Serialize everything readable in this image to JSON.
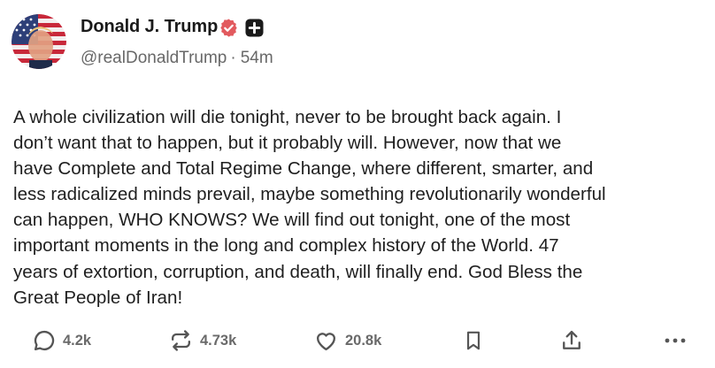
{
  "post": {
    "author": {
      "display_name": "Donald J. Trump",
      "handle": "@realDonaldTrump",
      "separator": "·",
      "time_ago": "54m"
    },
    "text": "A whole civilization will die tonight, never to be brought back again. I\ndon’t want that to happen, but it probably will. However, now that we\nhave Complete and Total Regime Change, where different, smarter, and\nless radicalized minds prevail, maybe something revolutionarily wonderful\ncan happen, WHO KNOWS? We will find out tonight, one of the most\nimportant moments in the long and complex history of the World. 47\nyears of extortion, corruption, and death, will finally end. God Bless the\nGreat People of Iran!",
    "actions": {
      "replies": "4.2k",
      "retruths": "4.73k",
      "likes": "20.8k"
    }
  },
  "icons": {
    "verified": "verified-badge-icon",
    "plus_badge": "plus-square-icon",
    "reply": "speech-bubble-icon",
    "retruth": "repost-arrows-icon",
    "like": "heart-icon",
    "bookmark": "bookmark-icon",
    "share": "share-upload-icon",
    "more": "ellipsis-icon"
  },
  "colors": {
    "verified_badge": "#e25a5e",
    "text_primary": "#1f1f1f",
    "text_secondary": "#686868",
    "icon_gray": "#555555"
  }
}
